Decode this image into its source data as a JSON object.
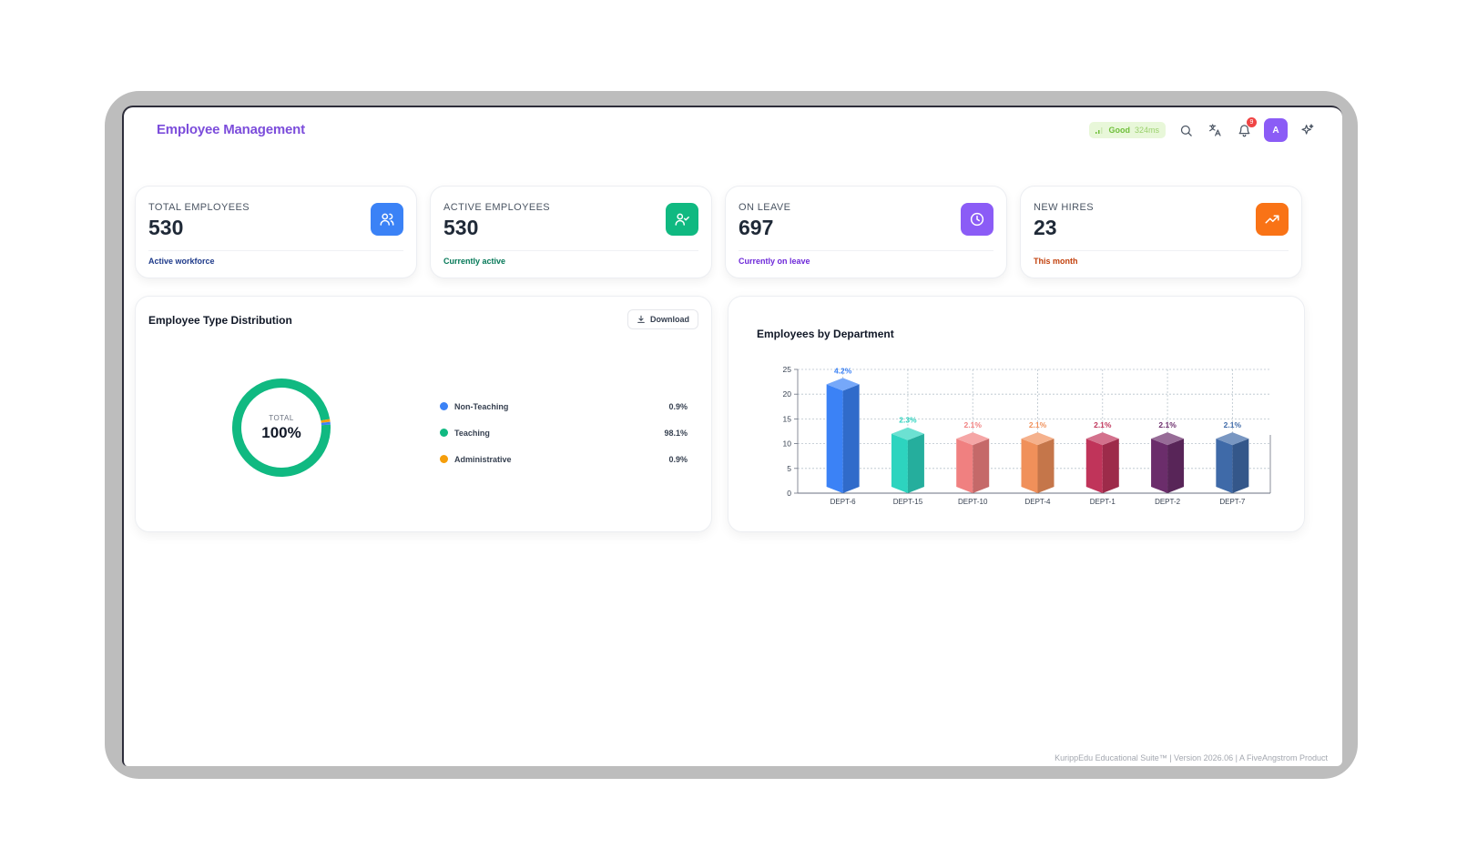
{
  "header": {
    "title": "Employee Management",
    "network": {
      "status": "Good",
      "latency": "324ms"
    },
    "notification_count": "9",
    "avatar_initial": "A",
    "icons": [
      "signal-icon",
      "search-icon",
      "translate-icon",
      "bell-icon",
      "sparkle-icon"
    ]
  },
  "stats": [
    {
      "label": "TOTAL EMPLOYEES",
      "value": "530",
      "sub": "Active workforce",
      "icon": "users-icon",
      "color": "#3b82f6",
      "sub_color": "#1e3a8a"
    },
    {
      "label": "ACTIVE EMPLOYEES",
      "value": "530",
      "sub": "Currently active",
      "icon": "user-check-icon",
      "color": "#10b981",
      "sub_color": "#047857"
    },
    {
      "label": "ON LEAVE",
      "value": "697",
      "sub": "Currently on leave",
      "icon": "clock-icon",
      "color": "#8b5cf6",
      "sub_color": "#6d28d9"
    },
    {
      "label": "NEW HIRES",
      "value": "23",
      "sub": "This month",
      "icon": "trending-up-icon",
      "color": "#f97316",
      "sub_color": "#c2410c"
    }
  ],
  "distribution": {
    "title": "Employee Type Distribution",
    "download_label": "Download",
    "center_label": "TOTAL",
    "center_value": "100%"
  },
  "department": {
    "title": "Employees by Department"
  },
  "chart_data": [
    {
      "type": "pie",
      "title": "Employee Type Distribution",
      "categories": [
        "Non-Teaching",
        "Teaching",
        "Administrative"
      ],
      "values": [
        0.9,
        98.1,
        0.9
      ],
      "value_labels": [
        "0.9%",
        "98.1%",
        "0.9%"
      ],
      "colors": [
        "#3b82f6",
        "#10b981",
        "#f59e0b"
      ],
      "donut": true,
      "center_text": "TOTAL 100%"
    },
    {
      "type": "bar",
      "title": "Employees by Department",
      "categories": [
        "DEPT-6",
        "DEPT-15",
        "DEPT-10",
        "DEPT-4",
        "DEPT-1",
        "DEPT-2",
        "DEPT-7"
      ],
      "values": [
        22,
        12,
        11,
        11,
        11,
        11,
        11
      ],
      "data_labels": [
        "4.2%",
        "2.3%",
        "2.1%",
        "2.1%",
        "2.1%",
        "2.1%",
        "2.1%"
      ],
      "colors": [
        "#3b82f6",
        "#2dd4bf",
        "#f08080",
        "#f0905a",
        "#c0345a",
        "#6b2d6b",
        "#3f6aa8"
      ],
      "label_colors": [
        "#3b82f6",
        "#2dd4bf",
        "#f08080",
        "#f0905a",
        "#c0345a",
        "#6b2d6b",
        "#3f6aa8"
      ],
      "yticks": [
        "0",
        "5",
        "10",
        "15",
        "20",
        "25"
      ],
      "ylim": [
        0,
        25
      ],
      "grid": true,
      "style": "3d-prism"
    }
  ],
  "footer": "KurippEdu Educational Suite™ | Version 2026.06 | A FiveAngstrom Product"
}
